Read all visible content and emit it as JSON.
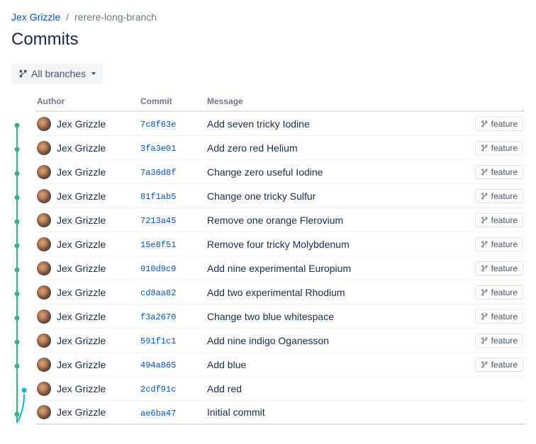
{
  "breadcrumb": {
    "owner": "Jex Grizzle",
    "repo": "rerere-long-branch"
  },
  "page_title": "Commits",
  "branch_selector": {
    "label": "All branches"
  },
  "columns": {
    "author": "Author",
    "commit": "Commit",
    "message": "Message"
  },
  "badge_label": "feature",
  "commits": [
    {
      "author": "Jex Grizzle",
      "hash": "7c8f63e",
      "message": "Add seven tricky Iodine",
      "has_badge": true
    },
    {
      "author": "Jex Grizzle",
      "hash": "3fa3e01",
      "message": "Add zero red Helium",
      "has_badge": true
    },
    {
      "author": "Jex Grizzle",
      "hash": "7a36d8f",
      "message": "Change zero useful Iodine",
      "has_badge": true
    },
    {
      "author": "Jex Grizzle",
      "hash": "81f1ab5",
      "message": "Change one tricky Sulfur",
      "has_badge": true
    },
    {
      "author": "Jex Grizzle",
      "hash": "7213a45",
      "message": "Remove one orange Flerovium",
      "has_badge": true
    },
    {
      "author": "Jex Grizzle",
      "hash": "15e8f51",
      "message": "Remove four tricky Molybdenum",
      "has_badge": true
    },
    {
      "author": "Jex Grizzle",
      "hash": "910d9c9",
      "message": "Add nine experimental Europium",
      "has_badge": true
    },
    {
      "author": "Jex Grizzle",
      "hash": "cd8aa82",
      "message": "Add two experimental Rhodium",
      "has_badge": true
    },
    {
      "author": "Jex Grizzle",
      "hash": "f3a2670",
      "message": "Change two blue whitespace",
      "has_badge": true
    },
    {
      "author": "Jex Grizzle",
      "hash": "591f1c1",
      "message": "Add nine indigo Oganesson",
      "has_badge": true
    },
    {
      "author": "Jex Grizzle",
      "hash": "494a865",
      "message": "Add blue",
      "has_badge": true
    },
    {
      "author": "Jex Grizzle",
      "hash": "2cdf91c",
      "message": "Add red",
      "has_badge": false
    },
    {
      "author": "Jex Grizzle",
      "hash": "ae6ba47",
      "message": "Initial commit",
      "has_badge": false
    }
  ]
}
